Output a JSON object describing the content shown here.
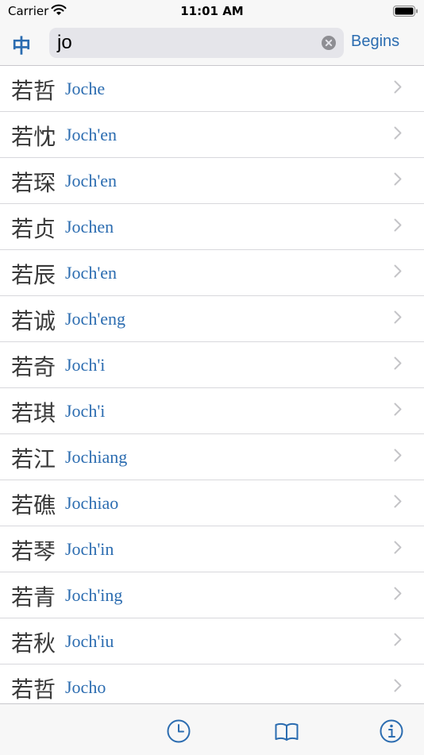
{
  "status": {
    "carrier": "Carrier",
    "time": "11:01 AM"
  },
  "search": {
    "lang_toggle": "中",
    "value": "jo",
    "mode_button": "Begins"
  },
  "results": [
    {
      "hanzi": "若哲",
      "roman": "Joche"
    },
    {
      "hanzi": "若忱",
      "roman": "Joch'en"
    },
    {
      "hanzi": "若琛",
      "roman": "Joch'en"
    },
    {
      "hanzi": "若贞",
      "roman": "Jochen"
    },
    {
      "hanzi": "若辰",
      "roman": "Joch'en"
    },
    {
      "hanzi": "若诚",
      "roman": "Joch'eng"
    },
    {
      "hanzi": "若奇",
      "roman": "Joch'i"
    },
    {
      "hanzi": "若琪",
      "roman": "Joch'i"
    },
    {
      "hanzi": "若江",
      "roman": "Jochiang"
    },
    {
      "hanzi": "若礁",
      "roman": "Jochiao"
    },
    {
      "hanzi": "若琴",
      "roman": "Joch'in"
    },
    {
      "hanzi": "若青",
      "roman": "Joch'ing"
    },
    {
      "hanzi": "若秋",
      "roman": "Joch'iu"
    },
    {
      "hanzi": "若哲",
      "roman": "Jocho"
    }
  ],
  "tabs": [
    {
      "icon": "clock-icon"
    },
    {
      "icon": "book-icon"
    },
    {
      "icon": "info-icon"
    }
  ],
  "colors": {
    "accent": "#2b6cb0",
    "bar_background": "#f7f7f7",
    "separator": "#d8d8dc"
  }
}
